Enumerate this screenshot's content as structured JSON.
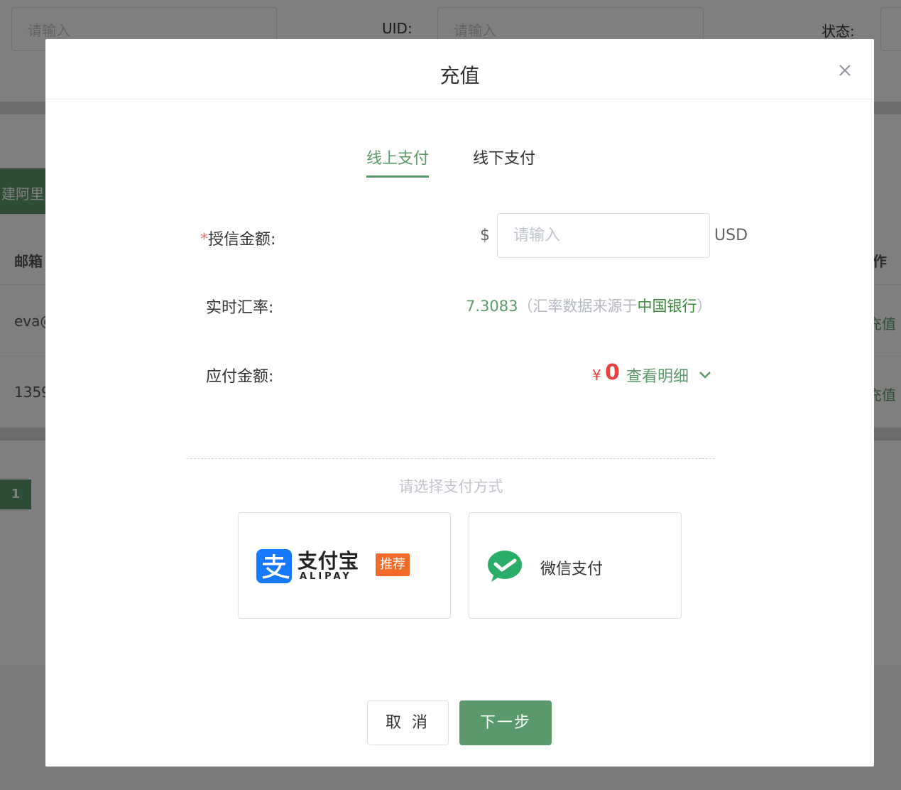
{
  "background": {
    "filter_placeholder": "请输入",
    "uid_label": "UID:",
    "uid_placeholder": "请输入",
    "status_label": "状态:",
    "create_button": "建阿里",
    "table_header_left": "邮箱",
    "table_header_right": "作",
    "rows": [
      {
        "email": "eva@",
        "action": "充值"
      },
      {
        "email": "1359",
        "action": "充值"
      }
    ],
    "current_page": "1"
  },
  "dialog": {
    "title": "充值",
    "tabs": [
      {
        "label": "线上支付",
        "active": true
      },
      {
        "label": "线下支付",
        "active": false
      }
    ],
    "credit_amount": {
      "label": "授信金额:",
      "required_mark": "*",
      "currency_symbol": "$",
      "placeholder": "请输入",
      "value": "",
      "unit": "USD"
    },
    "exchange_rate": {
      "label": "实时汇率:",
      "value": "7.3083",
      "note_prefix": "（汇率数据来源于",
      "source": "中国银行",
      "note_suffix": "）"
    },
    "payable": {
      "label": "应付金额:",
      "currency_symbol": "¥",
      "amount": "0",
      "detail_link": "查看明细"
    },
    "choose_payment_text": "请选择支付方式",
    "payment_methods": {
      "alipay": {
        "name_cn": "支付宝",
        "name_en": "ALIPAY",
        "badge": "推荐"
      },
      "wechat": {
        "name": "微信支付"
      }
    },
    "buttons": {
      "cancel": "取 消",
      "next": "下一步"
    }
  },
  "colors": {
    "primary_green": "#5a9a6a",
    "price_red": "#e8413f",
    "alipay_blue": "#1677ff",
    "wechat_green": "#2aae67",
    "badge_orange": "#f26b2a"
  }
}
